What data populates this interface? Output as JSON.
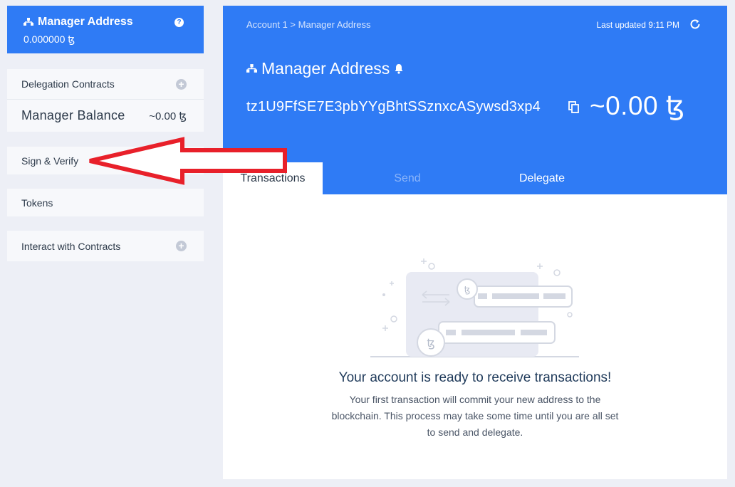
{
  "sidebar": {
    "header": {
      "title": "Manager Address",
      "balance": "0.000000 ꜩ"
    },
    "delegation_contracts": "Delegation Contracts",
    "manager_balance_label": "Manager Balance",
    "manager_balance_value": "~0.00 ꜩ",
    "sign_verify": "Sign & Verify",
    "tokens": "Tokens",
    "interact_contracts": "Interact with Contracts"
  },
  "main": {
    "breadcrumb": "Account 1 > Manager Address",
    "last_updated": "Last updated 9:11 PM",
    "title": "Manager Address",
    "address": "tz1U9FfSE7E3pbYYgBhtSSznxcASywsd3xp4",
    "balance": "~0.00 ꜩ",
    "tabs": [
      {
        "label": "Transactions",
        "active": true
      },
      {
        "label": "Send",
        "active": false
      },
      {
        "label": "Delegate",
        "active": false
      }
    ],
    "empty_title": "Your account is ready to receive transactions!",
    "empty_desc": "Your first transaction will commit your new address to the blockchain. This process may take some time until you are all set to send and delegate."
  },
  "colors": {
    "accent": "#2f7bf5",
    "annotation_arrow": "#e8202a"
  }
}
